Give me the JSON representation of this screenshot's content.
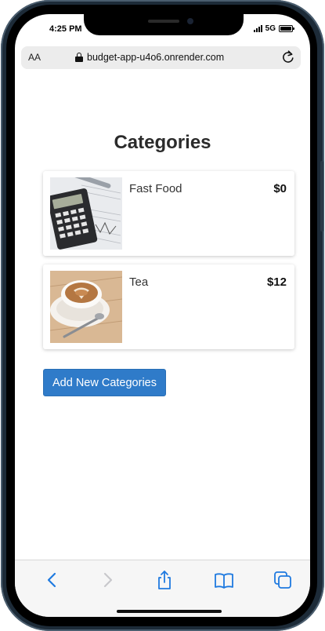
{
  "status_bar": {
    "time": "4:25 PM",
    "network": "5G"
  },
  "browser": {
    "text_size_label": "AA",
    "url": "budget-app-u4o6.onrender.com"
  },
  "page": {
    "title": "Categories",
    "categories": [
      {
        "name": "Fast Food",
        "amount": "$0",
        "image": "calculator-photo"
      },
      {
        "name": "Tea",
        "amount": "$12",
        "image": "coffee-cup-photo"
      }
    ],
    "add_button_label": "Add New Categories"
  },
  "colors": {
    "accent": "#2f7bc9",
    "safari_blue": "#1f7ae0",
    "frame": "#1d2b38"
  },
  "toolbar": {
    "icons": [
      "back-icon",
      "forward-icon",
      "share-icon",
      "bookmarks-icon",
      "tabs-icon"
    ]
  }
}
